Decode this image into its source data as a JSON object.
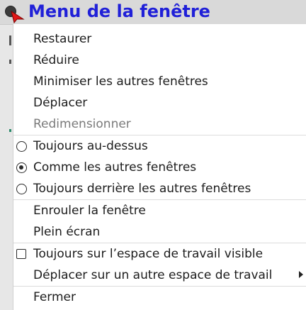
{
  "window": {
    "title": "Menu de la fenêtre"
  },
  "menu": {
    "items": [
      {
        "label": "Restaurer",
        "state": "enabled"
      },
      {
        "label": "Réduire",
        "state": "enabled"
      },
      {
        "label": "Minimiser les autres fenêtres",
        "state": "enabled"
      },
      {
        "label": "Déplacer",
        "state": "enabled"
      },
      {
        "label": "Redimensionner",
        "state": "disabled"
      },
      {
        "label": "Toujours au-dessus",
        "control": "radio",
        "checked": false
      },
      {
        "label": "Comme les autres fenêtres",
        "control": "radio",
        "checked": true
      },
      {
        "label": "Toujours derrière les autres fenêtres",
        "control": "radio",
        "checked": false
      },
      {
        "label": "Enrouler la fenêtre",
        "state": "enabled"
      },
      {
        "label": "Plein écran",
        "state": "enabled"
      },
      {
        "label": "Toujours sur l’espace de travail visible",
        "control": "checkbox",
        "checked": false
      },
      {
        "label": "Déplacer sur un autre espace de travail",
        "has_submenu": true
      },
      {
        "label": "Fermer",
        "state": "enabled"
      }
    ]
  },
  "colors": {
    "title": "#2020d8",
    "pointer": "#e01818",
    "disabled_text": "#7a7a7a"
  },
  "icons": [
    "window-menu-icon",
    "mouse-pointer-icon",
    "radio-icon",
    "checkbox-icon",
    "submenu-arrow-icon"
  ]
}
